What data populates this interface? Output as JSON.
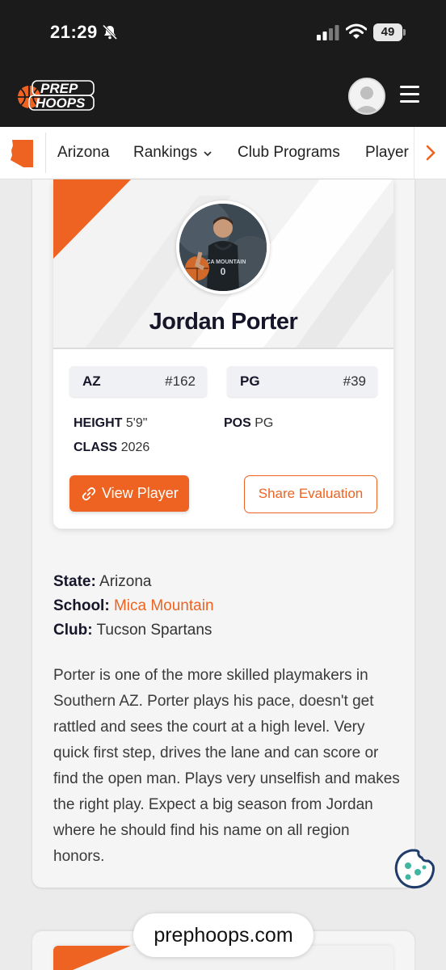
{
  "status_bar": {
    "time": "21:29",
    "battery": "49",
    "icons": [
      "bell-slash-icon",
      "signal-icon",
      "wifi-icon",
      "battery-icon"
    ]
  },
  "header": {
    "logo_line1": "PREP",
    "logo_line2": "HOOPS",
    "icons": [
      "profile-icon",
      "menu-icon"
    ]
  },
  "state_nav": {
    "state_icon": "arizona-state-icon",
    "items": [
      {
        "label": "Arizona"
      },
      {
        "label": "Rankings"
      },
      {
        "label": "Club Programs"
      },
      {
        "label": "Player"
      }
    ],
    "more_icon": "chevron-right-icon"
  },
  "player_card": {
    "name": "Jordan Porter",
    "jersey_text": "MICA MOUNTAIN",
    "jersey_number": "0",
    "state_rank": {
      "label": "AZ",
      "value": "#162"
    },
    "position_rank": {
      "label": "PG",
      "value": "#39"
    },
    "height": {
      "label": "HEIGHT",
      "value": "5'9\""
    },
    "class": {
      "label": "CLASS",
      "value": "2026"
    },
    "pos": {
      "label": "POS",
      "value": "PG"
    },
    "view_button": "View Player",
    "share_button": "Share Evaluation"
  },
  "details": {
    "state_label": "State:",
    "state_value": "Arizona",
    "school_label": "School:",
    "school_value": "Mica Mountain",
    "club_label": "Club:",
    "club_value": "Tucson Spartans"
  },
  "evaluation": "Porter is one of the more skilled playmakers in Southern AZ. Porter plays his pace, doesn't get rattled and sees the court at a high level. Very quick first step, drives the lane and can score or find the open man. Plays very unselfish and makes the right play. Expect a big season from Jordan where he should find his name on all region honors.",
  "browser": {
    "url": "prephoops.com"
  },
  "colors": {
    "accent": "#ee6321",
    "header_bg": "#1b1b1b",
    "text_dark": "#16162a"
  }
}
